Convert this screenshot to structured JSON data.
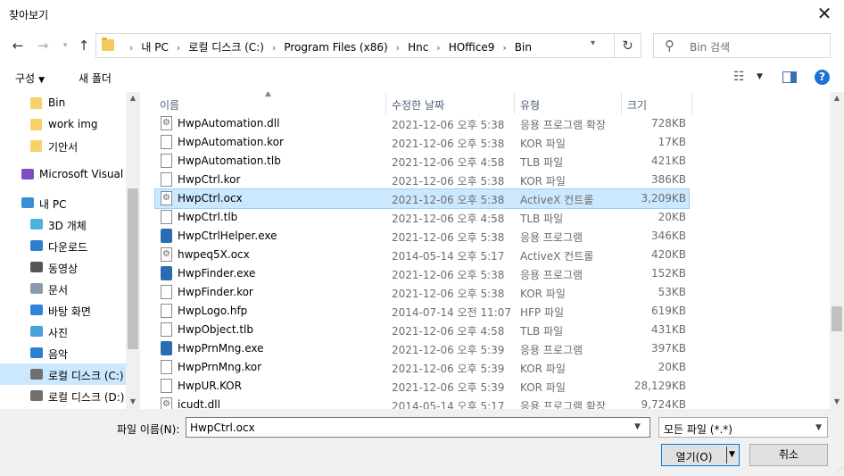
{
  "window": {
    "title": "찾아보기"
  },
  "nav": {
    "crumbs": [
      "내 PC",
      "로컬 디스크 (C:)",
      "Program Files (x86)",
      "Hnc",
      "HOffice9",
      "Bin"
    ]
  },
  "search": {
    "placeholder": "Bin 검색"
  },
  "toolbar": {
    "organize": "구성",
    "new_folder": "새 폴더"
  },
  "sidebar": {
    "items": [
      {
        "label": "Bin",
        "icon": "folder-icon"
      },
      {
        "label": "work img",
        "icon": "folder-icon"
      },
      {
        "label": "기안서",
        "icon": "folder-icon"
      },
      {
        "label": "Microsoft Visual S",
        "icon": "visual-studio-icon"
      },
      {
        "label": "내 PC",
        "icon": "pc-icon"
      },
      {
        "label": "3D 개체",
        "icon": "cube-icon"
      },
      {
        "label": "다운로드",
        "icon": "download-icon"
      },
      {
        "label": "동영상",
        "icon": "video-icon"
      },
      {
        "label": "문서",
        "icon": "document-icon"
      },
      {
        "label": "바탕 화면",
        "icon": "desktop-icon"
      },
      {
        "label": "사진",
        "icon": "picture-icon"
      },
      {
        "label": "음악",
        "icon": "music-icon"
      },
      {
        "label": "로컬 디스크 (C:)",
        "icon": "drive-icon"
      },
      {
        "label": "로컬 디스크 (D:)",
        "icon": "drive-icon"
      }
    ]
  },
  "columns": {
    "name": "이름",
    "date": "수정한 날짜",
    "type": "유형",
    "size": "크기"
  },
  "files": [
    {
      "name": "HwpAutomation.dll",
      "date": "2021-12-06 오후 5:38",
      "type": "응용 프로그램 확장",
      "size": "728KB",
      "icon": "dll"
    },
    {
      "name": "HwpAutomation.kor",
      "date": "2021-12-06 오후 5:38",
      "type": "KOR 파일",
      "size": "17KB",
      "icon": "file"
    },
    {
      "name": "HwpAutomation.tlb",
      "date": "2021-12-06 오후 4:58",
      "type": "TLB 파일",
      "size": "421KB",
      "icon": "file"
    },
    {
      "name": "HwpCtrl.kor",
      "date": "2021-12-06 오후 5:38",
      "type": "KOR 파일",
      "size": "386KB",
      "icon": "file"
    },
    {
      "name": "HwpCtrl.ocx",
      "date": "2021-12-06 오후 5:38",
      "type": "ActiveX 컨트롤",
      "size": "3,209KB",
      "icon": "dll"
    },
    {
      "name": "HwpCtrl.tlb",
      "date": "2021-12-06 오후 4:58",
      "type": "TLB 파일",
      "size": "20KB",
      "icon": "file"
    },
    {
      "name": "HwpCtrlHelper.exe",
      "date": "2021-12-06 오후 5:38",
      "type": "응용 프로그램",
      "size": "346KB",
      "icon": "exe"
    },
    {
      "name": "hwpeq5X.ocx",
      "date": "2014-05-14 오후 5:17",
      "type": "ActiveX 컨트롤",
      "size": "420KB",
      "icon": "dll"
    },
    {
      "name": "HwpFinder.exe",
      "date": "2021-12-06 오후 5:38",
      "type": "응용 프로그램",
      "size": "152KB",
      "icon": "exe"
    },
    {
      "name": "HwpFinder.kor",
      "date": "2021-12-06 오후 5:38",
      "type": "KOR 파일",
      "size": "53KB",
      "icon": "file"
    },
    {
      "name": "HwpLogo.hfp",
      "date": "2014-07-14 오전 11:07",
      "type": "HFP 파일",
      "size": "619KB",
      "icon": "file"
    },
    {
      "name": "HwpObject.tlb",
      "date": "2021-12-06 오후 4:58",
      "type": "TLB 파일",
      "size": "431KB",
      "icon": "file"
    },
    {
      "name": "HwpPrnMng.exe",
      "date": "2021-12-06 오후 5:39",
      "type": "응용 프로그램",
      "size": "397KB",
      "icon": "exe"
    },
    {
      "name": "HwpPrnMng.kor",
      "date": "2021-12-06 오후 5:39",
      "type": "KOR 파일",
      "size": "20KB",
      "icon": "file"
    },
    {
      "name": "HwpUR.KOR",
      "date": "2021-12-06 오후 5:39",
      "type": "KOR 파일",
      "size": "28,129KB",
      "icon": "file"
    },
    {
      "name": "icudt.dll",
      "date": "2014-05-14 오후 5:17",
      "type": "응용 프로그램 확장",
      "size": "9,724KB",
      "icon": "dll"
    }
  ],
  "selected_file": "HwpCtrl.ocx",
  "bottom": {
    "filename_label": "파일 이름(N):",
    "filename_value": "HwpCtrl.ocx",
    "filetype_value": "모든 파일 (*.*)",
    "open_label": "열기(O)",
    "cancel_label": "취소"
  },
  "colors": {
    "selection": "#cce8ff",
    "accent": "#0078d7",
    "folder": "#f7d26a"
  }
}
